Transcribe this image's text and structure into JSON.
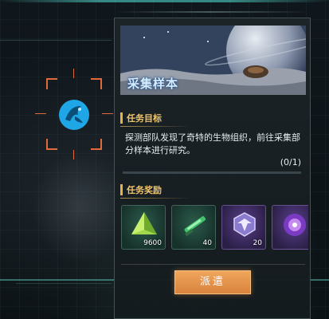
{
  "mission": {
    "banner_title": "采集样本",
    "objective_header": "任务目标",
    "objective_text": "探测部队发现了奇特的生物组织，前往采集部分样本进行研究。",
    "progress_text": "(0/1)",
    "progress_fraction": 0.0,
    "rewards_header": "任务奖励",
    "rewards": [
      {
        "icon": "green-pyramid-crystal-icon",
        "count": "9600",
        "style": "green"
      },
      {
        "icon": "green-blade-component-icon",
        "count": "40",
        "style": "green"
      },
      {
        "icon": "purple-wing-emblem-icon",
        "count": "20",
        "style": "purple"
      },
      {
        "icon": "purple-orb-icon",
        "count": "",
        "style": "purple"
      }
    ],
    "dispatch_label": "派遣"
  },
  "colors": {
    "accent_gold": "#f0c46a",
    "button_orange": "#e0903f",
    "reticle_orange": "#e06a3c",
    "target_blue": "#1fa6e6"
  }
}
